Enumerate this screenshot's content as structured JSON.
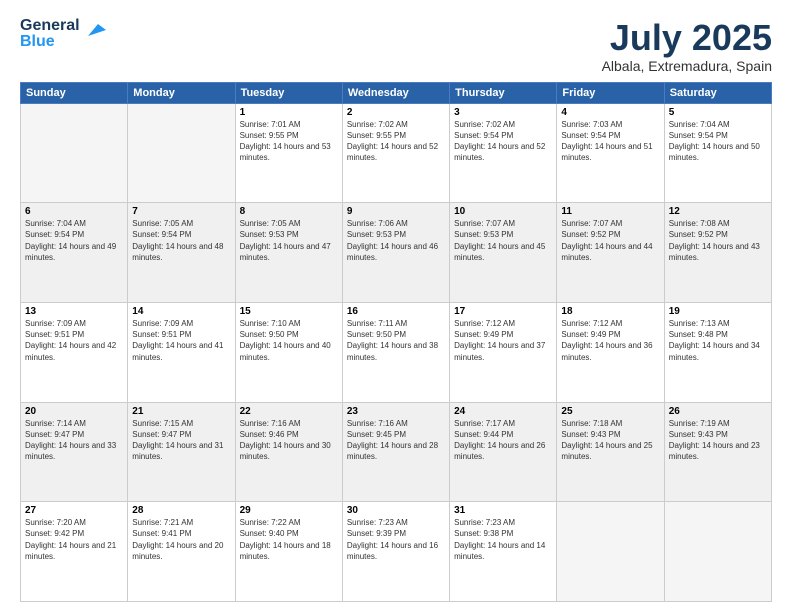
{
  "header": {
    "logo_line1": "General",
    "logo_line2": "Blue",
    "month": "July 2025",
    "location": "Albala, Extremadura, Spain"
  },
  "weekdays": [
    "Sunday",
    "Monday",
    "Tuesday",
    "Wednesday",
    "Thursday",
    "Friday",
    "Saturday"
  ],
  "weeks": [
    {
      "shade": false,
      "days": [
        {
          "date": "",
          "info": ""
        },
        {
          "date": "",
          "info": ""
        },
        {
          "date": "1",
          "info": "Sunrise: 7:01 AM\nSunset: 9:55 PM\nDaylight: 14 hours and 53 minutes."
        },
        {
          "date": "2",
          "info": "Sunrise: 7:02 AM\nSunset: 9:55 PM\nDaylight: 14 hours and 52 minutes."
        },
        {
          "date": "3",
          "info": "Sunrise: 7:02 AM\nSunset: 9:54 PM\nDaylight: 14 hours and 52 minutes."
        },
        {
          "date": "4",
          "info": "Sunrise: 7:03 AM\nSunset: 9:54 PM\nDaylight: 14 hours and 51 minutes."
        },
        {
          "date": "5",
          "info": "Sunrise: 7:04 AM\nSunset: 9:54 PM\nDaylight: 14 hours and 50 minutes."
        }
      ]
    },
    {
      "shade": true,
      "days": [
        {
          "date": "6",
          "info": "Sunrise: 7:04 AM\nSunset: 9:54 PM\nDaylight: 14 hours and 49 minutes."
        },
        {
          "date": "7",
          "info": "Sunrise: 7:05 AM\nSunset: 9:54 PM\nDaylight: 14 hours and 48 minutes."
        },
        {
          "date": "8",
          "info": "Sunrise: 7:05 AM\nSunset: 9:53 PM\nDaylight: 14 hours and 47 minutes."
        },
        {
          "date": "9",
          "info": "Sunrise: 7:06 AM\nSunset: 9:53 PM\nDaylight: 14 hours and 46 minutes."
        },
        {
          "date": "10",
          "info": "Sunrise: 7:07 AM\nSunset: 9:53 PM\nDaylight: 14 hours and 45 minutes."
        },
        {
          "date": "11",
          "info": "Sunrise: 7:07 AM\nSunset: 9:52 PM\nDaylight: 14 hours and 44 minutes."
        },
        {
          "date": "12",
          "info": "Sunrise: 7:08 AM\nSunset: 9:52 PM\nDaylight: 14 hours and 43 minutes."
        }
      ]
    },
    {
      "shade": false,
      "days": [
        {
          "date": "13",
          "info": "Sunrise: 7:09 AM\nSunset: 9:51 PM\nDaylight: 14 hours and 42 minutes."
        },
        {
          "date": "14",
          "info": "Sunrise: 7:09 AM\nSunset: 9:51 PM\nDaylight: 14 hours and 41 minutes."
        },
        {
          "date": "15",
          "info": "Sunrise: 7:10 AM\nSunset: 9:50 PM\nDaylight: 14 hours and 40 minutes."
        },
        {
          "date": "16",
          "info": "Sunrise: 7:11 AM\nSunset: 9:50 PM\nDaylight: 14 hours and 38 minutes."
        },
        {
          "date": "17",
          "info": "Sunrise: 7:12 AM\nSunset: 9:49 PM\nDaylight: 14 hours and 37 minutes."
        },
        {
          "date": "18",
          "info": "Sunrise: 7:12 AM\nSunset: 9:49 PM\nDaylight: 14 hours and 36 minutes."
        },
        {
          "date": "19",
          "info": "Sunrise: 7:13 AM\nSunset: 9:48 PM\nDaylight: 14 hours and 34 minutes."
        }
      ]
    },
    {
      "shade": true,
      "days": [
        {
          "date": "20",
          "info": "Sunrise: 7:14 AM\nSunset: 9:47 PM\nDaylight: 14 hours and 33 minutes."
        },
        {
          "date": "21",
          "info": "Sunrise: 7:15 AM\nSunset: 9:47 PM\nDaylight: 14 hours and 31 minutes."
        },
        {
          "date": "22",
          "info": "Sunrise: 7:16 AM\nSunset: 9:46 PM\nDaylight: 14 hours and 30 minutes."
        },
        {
          "date": "23",
          "info": "Sunrise: 7:16 AM\nSunset: 9:45 PM\nDaylight: 14 hours and 28 minutes."
        },
        {
          "date": "24",
          "info": "Sunrise: 7:17 AM\nSunset: 9:44 PM\nDaylight: 14 hours and 26 minutes."
        },
        {
          "date": "25",
          "info": "Sunrise: 7:18 AM\nSunset: 9:43 PM\nDaylight: 14 hours and 25 minutes."
        },
        {
          "date": "26",
          "info": "Sunrise: 7:19 AM\nSunset: 9:43 PM\nDaylight: 14 hours and 23 minutes."
        }
      ]
    },
    {
      "shade": false,
      "days": [
        {
          "date": "27",
          "info": "Sunrise: 7:20 AM\nSunset: 9:42 PM\nDaylight: 14 hours and 21 minutes."
        },
        {
          "date": "28",
          "info": "Sunrise: 7:21 AM\nSunset: 9:41 PM\nDaylight: 14 hours and 20 minutes."
        },
        {
          "date": "29",
          "info": "Sunrise: 7:22 AM\nSunset: 9:40 PM\nDaylight: 14 hours and 18 minutes."
        },
        {
          "date": "30",
          "info": "Sunrise: 7:23 AM\nSunset: 9:39 PM\nDaylight: 14 hours and 16 minutes."
        },
        {
          "date": "31",
          "info": "Sunrise: 7:23 AM\nSunset: 9:38 PM\nDaylight: 14 hours and 14 minutes."
        },
        {
          "date": "",
          "info": ""
        },
        {
          "date": "",
          "info": ""
        }
      ]
    }
  ]
}
